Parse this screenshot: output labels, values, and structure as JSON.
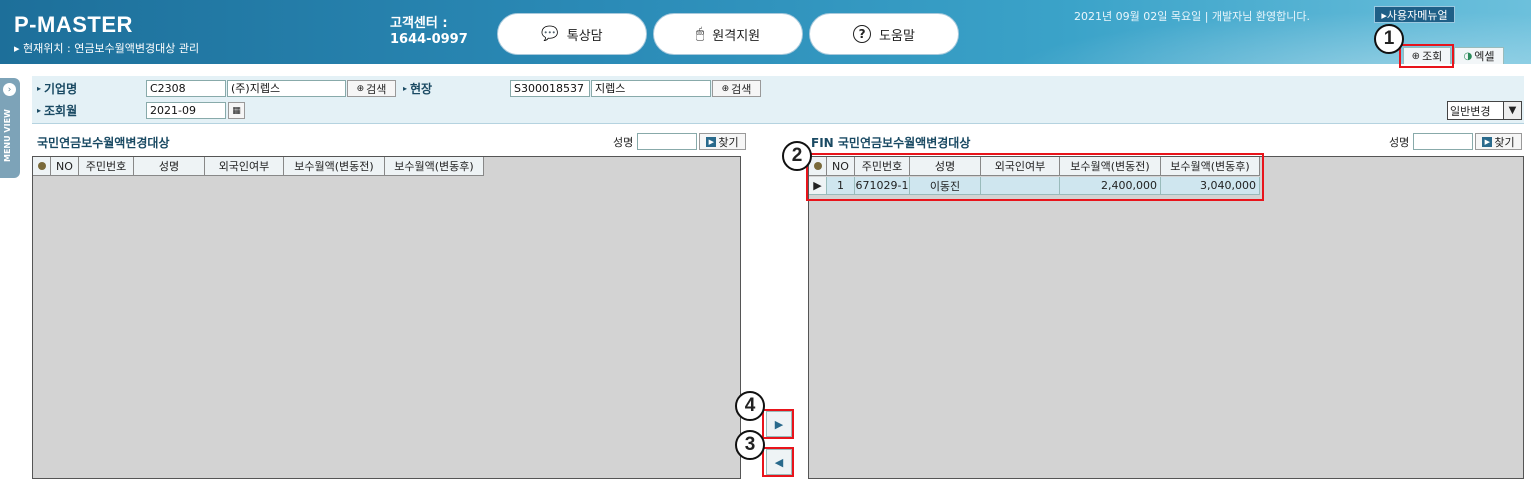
{
  "header": {
    "logo": "P-MASTER",
    "location": "▸ 현재위치 : 연금보수월액변경대상 관리",
    "cs_label": "고객센터 :",
    "cs_phone": "1644-0997",
    "buttons": [
      {
        "label": "톡상담",
        "icon": "chat-bubble-icon"
      },
      {
        "label": "원격지원",
        "icon": "mouse-icon"
      },
      {
        "label": "도움말",
        "icon": "question-icon"
      }
    ],
    "date_line": "2021년 09월 02일 목요일 | 개발자님 환영합니다.",
    "manual": "▸사용자메뉴얼",
    "tab_search": "조회",
    "tab_excel": "엑셀"
  },
  "menuview": {
    "label": "MENU VIEW"
  },
  "search": {
    "company_label": "기업명",
    "company_code": "C2308",
    "company_name": "(주)지렙스",
    "search_btn": "검색",
    "site_label": "현장",
    "site_code": "S300018537",
    "site_name": "지렙스",
    "month_label": "조회월",
    "month_value": "2021-09",
    "mode_select": "일반변경"
  },
  "left_panel": {
    "title": "국민연금보수월액변경대상",
    "name_label": "성명",
    "find_btn": "찾기",
    "columns": [
      "NO",
      "주민번호",
      "성명",
      "외국인여부",
      "보수월액(변동전)",
      "보수월액(변동후)"
    ]
  },
  "right_panel": {
    "title": "FIN 국민연금보수월액변경대상",
    "name_label": "성명",
    "find_btn": "찾기",
    "columns": [
      "NO",
      "주민번호",
      "성명",
      "외국인여부",
      "보수월액(변동전)",
      "보수월액(변동후)"
    ],
    "rows": [
      {
        "no": "1",
        "jumin": "671029-1",
        "name": "이동진",
        "foreign": "",
        "before": "2,400,000",
        "after": "3,040,000"
      }
    ]
  },
  "annotations": [
    "1",
    "2",
    "3",
    "4"
  ],
  "colors": {
    "accent": "#2b8bb7",
    "annotation": "#e8141b"
  }
}
